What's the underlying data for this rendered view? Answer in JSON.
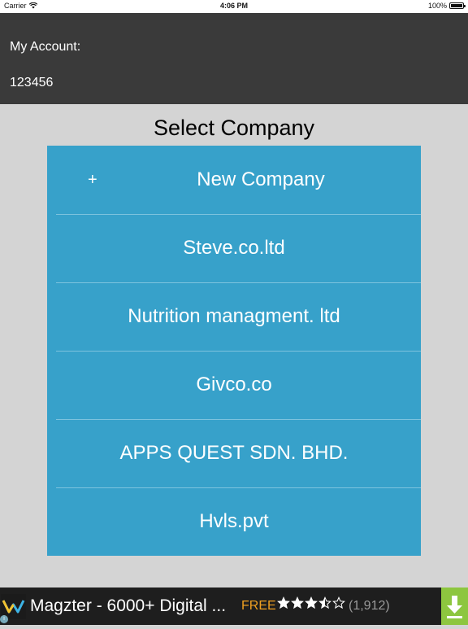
{
  "status_bar": {
    "carrier": "Carrier",
    "time": "4:06 PM",
    "battery": "100%",
    "battery_level": 1.0
  },
  "header": {
    "label": "My Account:",
    "account_number": "123456"
  },
  "title": "Select Company",
  "companies": {
    "new": {
      "icon": "+",
      "label": "New Company"
    },
    "items": [
      {
        "label": "Steve.co.ltd"
      },
      {
        "label": "Nutrition managment. ltd"
      },
      {
        "label": "Givco.co"
      },
      {
        "label": "APPS QUEST SDN. BHD."
      },
      {
        "label": "Hvls.pvt"
      }
    ]
  },
  "ad": {
    "title": "Magzter - 6000+ Digital ...",
    "price": "FREE",
    "rating": 3.5,
    "rating_max": 5,
    "rating_count": "(1,912)",
    "colors": {
      "price": "#f0a020",
      "download": "#8dc63f"
    },
    "icons": [
      "magzter-logo-icon",
      "info-icon",
      "star-icon",
      "download-icon"
    ]
  }
}
